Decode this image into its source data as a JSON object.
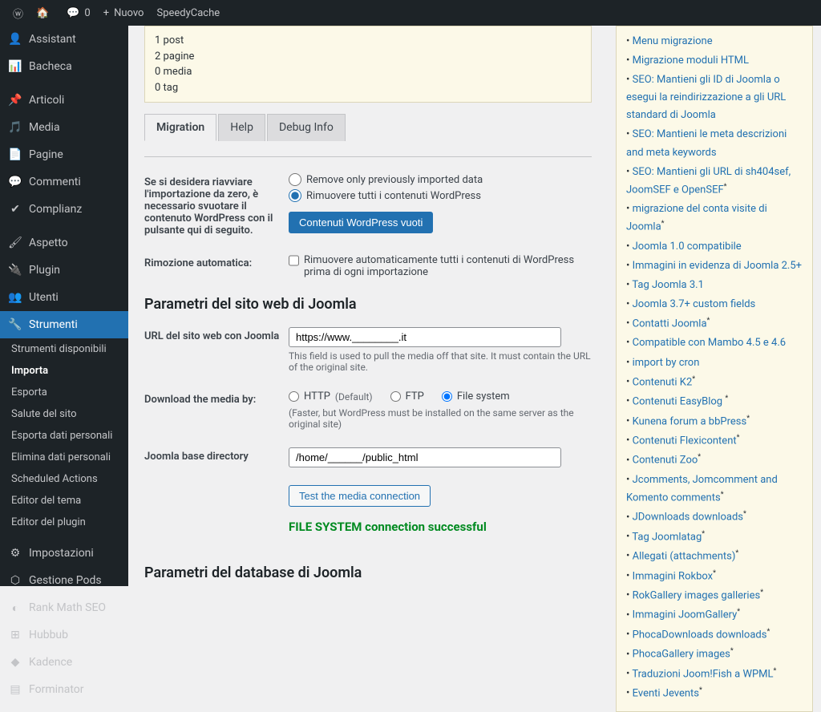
{
  "adminbar": {
    "site_name": "",
    "comments_count": "0",
    "nuovo": "Nuovo",
    "speedycache": "SpeedyCache"
  },
  "sidebar": {
    "items": [
      {
        "icon": "👤",
        "label": "Assistant"
      },
      {
        "icon": "📊",
        "label": "Bacheca"
      },
      {
        "icon": "📌",
        "label": "Articoli"
      },
      {
        "icon": "🎵",
        "label": "Media"
      },
      {
        "icon": "📄",
        "label": "Pagine"
      },
      {
        "icon": "💬",
        "label": "Commenti"
      },
      {
        "icon": "✔",
        "label": "Complianz"
      },
      {
        "icon": "🖌",
        "label": "Aspetto"
      },
      {
        "icon": "🔌",
        "label": "Plugin"
      },
      {
        "icon": "👥",
        "label": "Utenti"
      },
      {
        "icon": "🔧",
        "label": "Strumenti"
      }
    ],
    "submenu": [
      "Strumenti disponibili",
      "Importa",
      "Esporta",
      "Salute del sito",
      "Esporta dati personali",
      "Elimina dati personali",
      "Scheduled Actions",
      "Editor del tema",
      "Editor del plugin"
    ],
    "items2": [
      {
        "icon": "⚙",
        "label": "Impostazioni"
      },
      {
        "icon": "⬡",
        "label": "Gestione Pods"
      },
      {
        "icon": "◐",
        "label": "Rank Math SEO"
      },
      {
        "icon": "⊞",
        "label": "Hubbub"
      },
      {
        "icon": "◆",
        "label": "Kadence"
      },
      {
        "icon": "▤",
        "label": "Forminator"
      }
    ]
  },
  "infobox": {
    "line1": "1 post",
    "line2": "2 pagine",
    "line3": "0 media",
    "line4": "0 tag"
  },
  "tabs": {
    "migration": "Migration",
    "help": "Help",
    "debug": "Debug Info"
  },
  "section_restart": {
    "label": "Se si desidera riavviare l'importazione da zero, è necessario svuotare il contenuto WordPress con il pulsante qui di seguito.",
    "radio1": "Remove only previously imported data",
    "radio2": "Rimuovere tutti i contenuti WordPress",
    "button": "Contenuti WordPress vuoti"
  },
  "section_auto": {
    "label": "Rimozione automatica:",
    "checkbox": "Rimuovere automaticamente tutti i contenuti di WordPress prima di ogni importazione"
  },
  "heading_joomla_params": "Parametri del sito web di Joomla",
  "section_url": {
    "label": "URL del sito web con Joomla",
    "value": "https://www.________.it",
    "help": "This field is used to pull the media off that site. It must contain the URL of the original site."
  },
  "section_download": {
    "label": "Download the media by:",
    "http": "HTTP",
    "http_suffix": "(Default)",
    "ftp": "FTP",
    "fs": "File system",
    "fs_suffix": "(Faster, but WordPress must be installed on the same server as the original site)"
  },
  "section_basedir": {
    "label": "Joomla base directory",
    "value": "/home/______/public_html"
  },
  "test_button": "Test the media connection",
  "success": "FILE SYSTEM connection successful",
  "heading_db": "Parametri del database di Joomla",
  "right_items": [
    "Menu migrazione",
    "Migrazione moduli HTML",
    "SEO: Mantieni gli ID di Joomla o esegui la reindirizzazione a gli URL standard di Joomla",
    "SEO: Mantieni le meta descrizioni and meta keywords",
    "SEO: Mantieni gli URL di sh404sef, JoomSEF e OpenSEF",
    "migrazione del conta visite di Joomla",
    "Joomla 1.0 compatibile",
    "Immagini in evidenza di Joomla 2.5+",
    "Tag Joomla 3.1",
    "Joomla 3.7+ custom fields",
    "Contatti Joomla",
    "Compatible con Mambo 4.5 e 4.6",
    "import by cron",
    "Contenuti K2",
    "Contenuti EasyBlog ",
    "Kunena forum a bbPress",
    "Contenuti Flexicontent",
    "Contenuti Zoo",
    "Jcomments, Jomcomment and Komento comments",
    "JDownloads downloads",
    "Tag Joomlatag",
    "Allegati (attachments)",
    "Immagini Rokbox",
    "RokGallery images galleries",
    "Immagini JoomGallery",
    "PhocaDownloads downloads",
    "PhocaGallery images",
    "Traduzioni Joom!Fish a WPML",
    "Eventi Jevents"
  ],
  "sup_indices": [
    4,
    5,
    10,
    13,
    14,
    15,
    16,
    17,
    18,
    19,
    20,
    21,
    22,
    23,
    24,
    25,
    26,
    27,
    28
  ]
}
